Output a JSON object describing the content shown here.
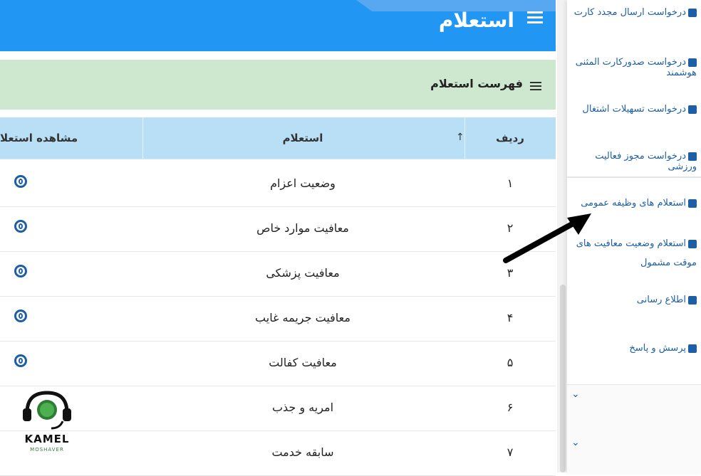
{
  "header": {
    "title": "استعلام"
  },
  "panel": {
    "title": "فهرست استعلام"
  },
  "table": {
    "columns": {
      "row": "ردیف",
      "inquiry": "استعلام",
      "view": "مشاهده استعلا"
    },
    "rows": [
      {
        "num": "۱",
        "title": "وضعیت اعزام"
      },
      {
        "num": "۲",
        "title": "معافیت موارد خاص"
      },
      {
        "num": "۳",
        "title": "معافیت پزشکی"
      },
      {
        "num": "۴",
        "title": "معافیت جریمه غایب"
      },
      {
        "num": "۵",
        "title": "معافیت کفالت"
      },
      {
        "num": "۶",
        "title": "امریه و جذب"
      },
      {
        "num": "۷",
        "title": "سابقه خدمت"
      }
    ]
  },
  "sidebar": {
    "items": [
      {
        "label": "درخواست ارسال مجدد کارت"
      },
      {
        "label": "درخواست صدورکارت المثنی هوشمند"
      },
      {
        "label": "درخواست تسهیلات اشتغال"
      },
      {
        "label": "درخواست مجوز فعالیت ورزشی"
      },
      {
        "label": "استعلام های وظیفه عمومی"
      },
      {
        "label": "استعلام وضعیت معافیت های موقت مشمول"
      },
      {
        "label": "اطلاع رسانی"
      },
      {
        "label": "پرسش و پاسخ"
      }
    ]
  },
  "logo": {
    "name": "KAMEL",
    "sub": "MOSHAVER"
  },
  "colors": {
    "header": "#2196f3",
    "panel": "#cde8cf",
    "table_head": "#b9dff7",
    "link": "#1d5fa5"
  }
}
